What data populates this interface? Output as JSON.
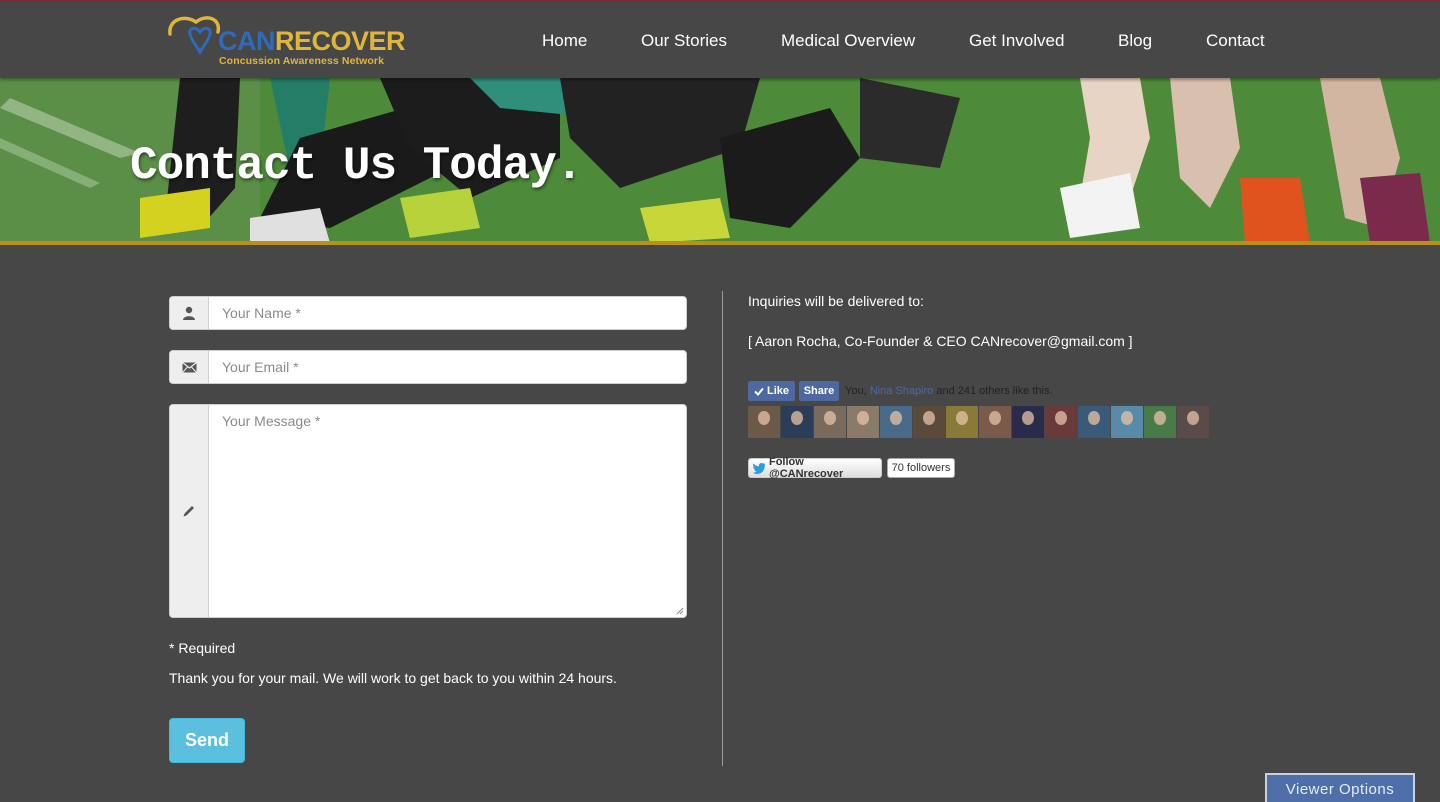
{
  "brand": {
    "name_part1": "CAN",
    "name_part2": "RECOVER",
    "tagline": "Concussion Awareness Network"
  },
  "nav": {
    "items": [
      {
        "label": "Home"
      },
      {
        "label": "Our Stories"
      },
      {
        "label": "Medical Overview"
      },
      {
        "label": "Get Involved"
      },
      {
        "label": "Blog"
      },
      {
        "label": "Contact"
      }
    ]
  },
  "hero": {
    "title": "Contact Us Today."
  },
  "form": {
    "name_placeholder": "Your Name *",
    "email_placeholder": "Your Email *",
    "message_placeholder": "Your Message *",
    "required_note": "* Required",
    "thanks_note": "Thank you for your mail. We will work to get back to you within 24 hours.",
    "send_label": "Send",
    "icons": {
      "name": "user-icon",
      "email": "envelope-icon",
      "message": "pencil-icon"
    }
  },
  "info": {
    "inquiries_label": "Inquiries will be delivered to:",
    "contact_line": "[ Aaron Rocha, Co-Founder & CEO CANrecover@gmail.com ]"
  },
  "facebook": {
    "like_label": "Like",
    "share_label": "Share",
    "text_prefix": "You, ",
    "friend_name": "Nina Shapiro",
    "text_suffix": " and 241 others like this."
  },
  "twitter": {
    "follow_label": "Follow @CANrecover",
    "followers": "70 followers"
  },
  "viewer_options": {
    "label": "Viewer Options"
  },
  "colors": {
    "background": "#474747",
    "hero_border": "#b8901e",
    "send_button": "#5bc0de",
    "facebook": "#4e69a2",
    "viewer_options": "#4f6fa8",
    "brand_blue": "#2e6bb8",
    "brand_gold": "#e0b63a"
  }
}
